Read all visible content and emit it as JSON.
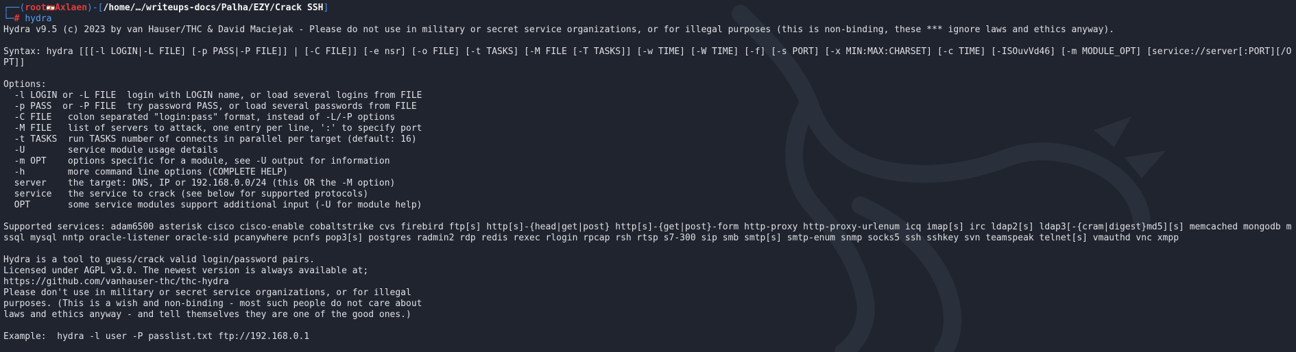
{
  "prompt": {
    "corner_top": "┌──(",
    "user": "root",
    "flag_icon": "flag-icon",
    "host": "Axlaen",
    "close_paren": ")-[",
    "path": "/home/…/writeups-docs/Palha/EZY/Crack SSH",
    "close_bracket": "]",
    "corner_bottom": "└─",
    "hash": "# ",
    "command": "hydra"
  },
  "output": {
    "banner": "Hydra v9.5 (c) 2023 by van Hauser/THC & David Maciejak - Please do not use in military or secret service organizations, or for illegal purposes (this is non-binding, these *** ignore laws and ethics anyway).",
    "syntax": "Syntax: hydra [[[-l LOGIN|-L FILE] [-p PASS|-P FILE]] | [-C FILE]] [-e nsr] [-o FILE] [-t TASKS] [-M FILE [-T TASKS]] [-w TIME] [-W TIME] [-f] [-s PORT] [-x MIN:MAX:CHARSET] [-c TIME] [-ISOuvVd46] [-m MODULE_OPT] [service://server[:PORT][/OPT]]",
    "options_header": "Options:",
    "options": [
      "  -l LOGIN or -L FILE  login with LOGIN name, or load several logins from FILE",
      "  -p PASS  or -P FILE  try password PASS, or load several passwords from FILE",
      "  -C FILE   colon separated \"login:pass\" format, instead of -L/-P options",
      "  -M FILE   list of servers to attack, one entry per line, ':' to specify port",
      "  -t TASKS  run TASKS number of connects in parallel per target (default: 16)",
      "  -U        service module usage details",
      "  -m OPT    options specific for a module, see -U output for information",
      "  -h        more command line options (COMPLETE HELP)",
      "  server    the target: DNS, IP or 192.168.0.0/24 (this OR the -M option)",
      "  service   the service to crack (see below for supported protocols)",
      "  OPT       some service modules support additional input (-U for module help)"
    ],
    "supported": "Supported services: adam6500 asterisk cisco cisco-enable cobaltstrike cvs firebird ftp[s] http[s]-{head|get|post} http[s]-{get|post}-form http-proxy http-proxy-urlenum icq imap[s] irc ldap2[s] ldap3[-{cram|digest}md5][s] memcached mongodb mssql mysql nntp oracle-listener oracle-sid pcanywhere pcnfs pop3[s] postgres radmin2 rdp redis rexec rlogin rpcap rsh rtsp s7-300 sip smb smtp[s] smtp-enum snmp socks5 ssh sshkey svn teamspeak telnet[s] vmauthd vnc xmpp",
    "about": [
      "Hydra is a tool to guess/crack valid login/password pairs.",
      "Licensed under AGPL v3.0. The newest version is always available at;",
      "https://github.com/vanhauser-thc/thc-hydra",
      "Please don't use in military or secret service organizations, or for illegal",
      "purposes. (This is a wish and non-binding - most such people do not care about",
      "laws and ethics anyway - and tell themselves they are one of the good ones.)"
    ],
    "example": "Example:  hydra -l user -P passlist.txt ftp://192.168.0.1"
  },
  "colors": {
    "background": "#1f242e",
    "text": "#dfe1e4",
    "prompt_frame": "#4e8ee8",
    "prompt_user": "#e63b3b",
    "command": "#5aa0f2"
  }
}
